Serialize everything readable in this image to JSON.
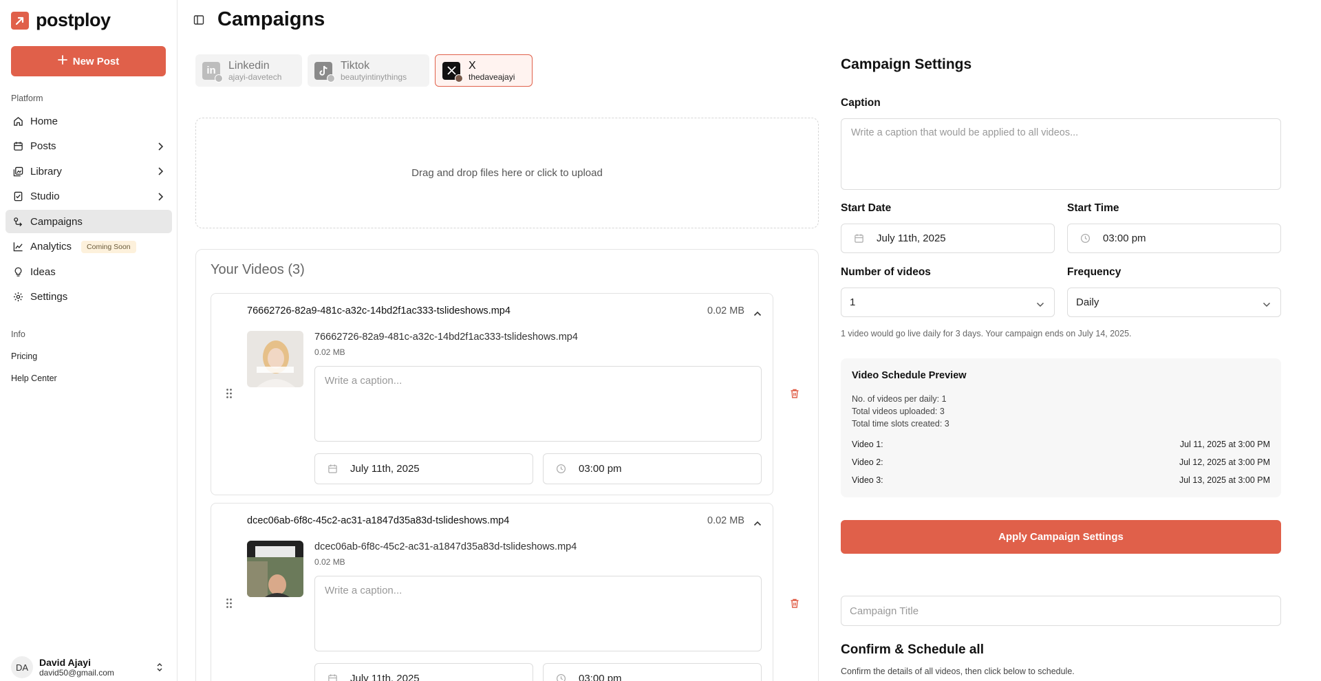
{
  "brand": {
    "name": "postploy",
    "accent": "#e0604a"
  },
  "sidebar": {
    "new_post_label": "New Post",
    "platform_label": "Platform",
    "items": [
      {
        "label": "Home",
        "icon": "home-icon"
      },
      {
        "label": "Posts",
        "icon": "calendar-icon",
        "has_submenu": true
      },
      {
        "label": "Library",
        "icon": "library-icon",
        "has_submenu": true
      },
      {
        "label": "Studio",
        "icon": "studio-icon",
        "has_submenu": true
      },
      {
        "label": "Campaigns",
        "icon": "campaigns-icon",
        "active": true
      },
      {
        "label": "Analytics",
        "icon": "chart-icon",
        "badge": "Coming Soon"
      },
      {
        "label": "Ideas",
        "icon": "lightbulb-icon"
      },
      {
        "label": "Settings",
        "icon": "gear-icon"
      }
    ],
    "info_label": "Info",
    "info_links": [
      "Pricing",
      "Help Center"
    ],
    "user": {
      "initials": "DA",
      "name": "David Ajayi",
      "email": "david50@gmail.com"
    }
  },
  "header": {
    "title": "Campaigns"
  },
  "accounts": [
    {
      "platform": "Linkedin",
      "handle": "ajayi-davetech",
      "selected": false
    },
    {
      "platform": "Tiktok",
      "handle": "beautyintinythings",
      "selected": false
    },
    {
      "platform": "X",
      "handle": "thedaveajayi",
      "selected": true
    }
  ],
  "dropzone": {
    "text": "Drag and drop files here or click to upload"
  },
  "videos": {
    "title": "Your Videos (3)",
    "items": [
      {
        "filename": "76662726-82a9-481c-a32c-14bd2f1ac333-tslideshows.mp4",
        "size": "0.02 MB",
        "caption_placeholder": "Write a caption...",
        "date": "July 11th, 2025",
        "time": "03:00 pm"
      },
      {
        "filename": "dcec06ab-6f8c-45c2-ac31-a1847d35a83d-tslideshows.mp4",
        "size": "0.02 MB",
        "caption_placeholder": "Write a caption...",
        "date": "July 11th, 2025",
        "time": "03:00 pm"
      }
    ]
  },
  "settings": {
    "title": "Campaign Settings",
    "caption_label": "Caption",
    "caption_placeholder": "Write a caption that would be applied to all videos...",
    "start_date_label": "Start Date",
    "start_date": "July 11th, 2025",
    "start_time_label": "Start Time",
    "start_time": "03:00 pm",
    "num_videos_label": "Number of videos",
    "num_videos": "1",
    "frequency_label": "Frequency",
    "frequency": "Daily",
    "helper": "1 video would go live daily for 3 days. Your campaign ends on July 14, 2025.",
    "preview": {
      "title": "Video Schedule Preview",
      "stats": [
        "No. of videos per daily: 1",
        "Total videos uploaded: 3",
        "Total time slots created: 3"
      ],
      "rows": [
        {
          "label": "Video 1:",
          "when": "Jul 11, 2025 at 3:00 PM"
        },
        {
          "label": "Video 2:",
          "when": "Jul 12, 2025 at 3:00 PM"
        },
        {
          "label": "Video 3:",
          "when": "Jul 13, 2025 at 3:00 PM"
        }
      ]
    },
    "apply_label": "Apply Campaign Settings",
    "campaign_title_placeholder": "Campaign Title",
    "confirm_title": "Confirm & Schedule all",
    "confirm_sub": "Confirm the details of all videos, then click below to schedule."
  }
}
